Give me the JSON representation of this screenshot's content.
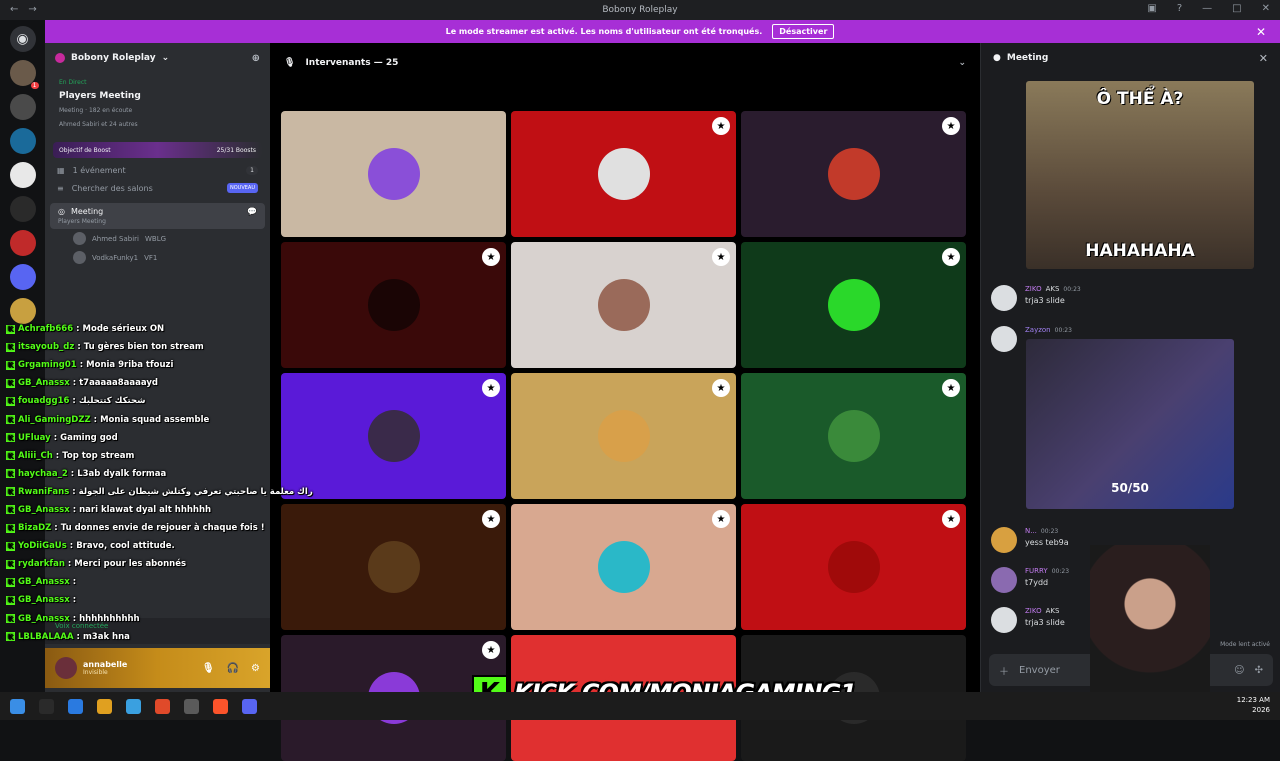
{
  "window": {
    "title": "Bobony Roleplay"
  },
  "banner": {
    "text": "Le mode streamer est activé. Les noms d'utilisateur ont été tronqués.",
    "button": "Désactiver"
  },
  "server": {
    "name": "Bobony Roleplay"
  },
  "event": {
    "live": "En Direct",
    "title": "Players Meeting",
    "channel": "Meeting",
    "listeners": "182 en écoute",
    "attendees": "Ahmed Sabiri et 24 autres"
  },
  "boost": {
    "label": "Objectif de Boost",
    "value": "25/31 Boosts"
  },
  "sidebar": {
    "events": {
      "label": "1 événement",
      "count": "1"
    },
    "search": {
      "label": "Chercher des salons",
      "badge": "NOUVEAU"
    },
    "voice_channel": {
      "name": "Meeting",
      "sub": "Players Meeting"
    },
    "voice_users": [
      {
        "name": "Ahmed Sabiri",
        "tag": "WBLG"
      },
      {
        "name": "VodkaFunky1",
        "tag": "VF1"
      }
    ],
    "voice_connected": "Voix connectée"
  },
  "user": {
    "name": "annabelle",
    "status": "Invisible"
  },
  "chat_overlay": [
    {
      "user": "Achrafb666",
      "text": "Mode sérieux ON"
    },
    {
      "user": "itsayoub_dz",
      "text": "Tu gères bien ton stream"
    },
    {
      "user": "Grgaming01",
      "text": "Monia 9riba tfouzi"
    },
    {
      "user": "GB_Anassx",
      "text": "t7aaaaa8aaaayd"
    },
    {
      "user": "fouadgg16",
      "text": "شحتكك كتتحلبك"
    },
    {
      "user": "Ali_GamingDZZ",
      "text": "Monia squad assemble"
    },
    {
      "user": "UFluay",
      "text": "Gaming god"
    },
    {
      "user": "Aliii_Ch",
      "text": "Top top stream"
    },
    {
      "user": "haychaa_2",
      "text": "L3ab dyalk formaa"
    },
    {
      "user": "RwaniFans",
      "text": "راك معلمة يا صاحبتي تعرفي وكتلش شيطان على الجولة"
    },
    {
      "user": "GB_Anassx",
      "text": "nari klawat dyal alt hhhhhh"
    },
    {
      "user": "BizaDZ",
      "text": "Tu donnes envie de rejouer à chaque fois !"
    },
    {
      "user": "YoDiiGaUs",
      "text": "Bravo, cool attitude."
    },
    {
      "user": "rydarkfan",
      "text": "Merci pour les abonnés"
    },
    {
      "user": "GB_Anassx",
      "text": ""
    },
    {
      "user": "GB_Anassx",
      "text": ""
    },
    {
      "user": "GB_Anassx",
      "text": "hhhhhhhhhh"
    },
    {
      "user": "LBLBALAAA",
      "text": "m3ak hna"
    }
  ],
  "stage": {
    "header": "Intervenants — 25"
  },
  "tiles": [
    {
      "bg": "#c9b8a3",
      "av": "#8a4fd8",
      "badge": false
    },
    {
      "bg": "#c00f14",
      "av": "#e0e0e0",
      "badge": true
    },
    {
      "bg": "#2a1c2e",
      "av": "#c23a2a",
      "badge": true
    },
    {
      "bg": "#3a0909",
      "av": "#1a0505",
      "badge": true
    },
    {
      "bg": "#d8d2cf",
      "av": "#9a6a5a",
      "badge": true
    },
    {
      "bg": "#0f3a1a",
      "av": "#2ad82a",
      "badge": true
    },
    {
      "bg": "#5a1ad8",
      "av": "#3a2a4a",
      "badge": true
    },
    {
      "bg": "#c9a45a",
      "av": "#d8a04a",
      "badge": true
    },
    {
      "bg": "#1a5a2a",
      "av": "#3a8a3a",
      "badge": true
    },
    {
      "bg": "#3a1a0a",
      "av": "#5a3a1a",
      "badge": true
    },
    {
      "bg": "#d8a890",
      "av": "#2ab8c8",
      "badge": true
    },
    {
      "bg": "#c00f14",
      "av": "#a00a0a",
      "badge": true
    },
    {
      "bg": "#2a1a2a",
      "av": "#8a3ad8",
      "badge": true
    },
    {
      "bg": "#e03030",
      "av": "#e03030",
      "badge": false
    },
    {
      "bg": "#1a1a1a",
      "av": "#2a2a2a",
      "badge": false
    }
  ],
  "right_panel": {
    "title": "Meeting",
    "gif_top": "Ô THỂ À?",
    "gif_bottom": "HAHAHAHA",
    "messages": [
      {
        "user": "ZIKO",
        "tag": "AKS",
        "time": "00:23",
        "text": "trja3 slide"
      },
      {
        "user": "Zayzon",
        "tag": "",
        "time": "00:23",
        "text": ""
      },
      {
        "user": "N...",
        "tag": "",
        "time": "00:23",
        "text": "yess teb9a"
      },
      {
        "user": "FURRY",
        "tag": "",
        "time": "00:23",
        "text": "t7ydd"
      },
      {
        "user": "ZIKO",
        "tag": "AKS",
        "time": "00:23",
        "text": "trja3 slide"
      }
    ],
    "video_label": "50/50",
    "slow_mode": "Mode lent activé",
    "composer_placeholder": "Envoyer"
  },
  "kick_url": "KICK.COM/MONIAGAMING1",
  "clock": {
    "time": "12:23 AM",
    "date": "2026"
  },
  "colors": {
    "accent": "#a72fd6",
    "kick": "#53fc18",
    "online": "#23a55a"
  }
}
